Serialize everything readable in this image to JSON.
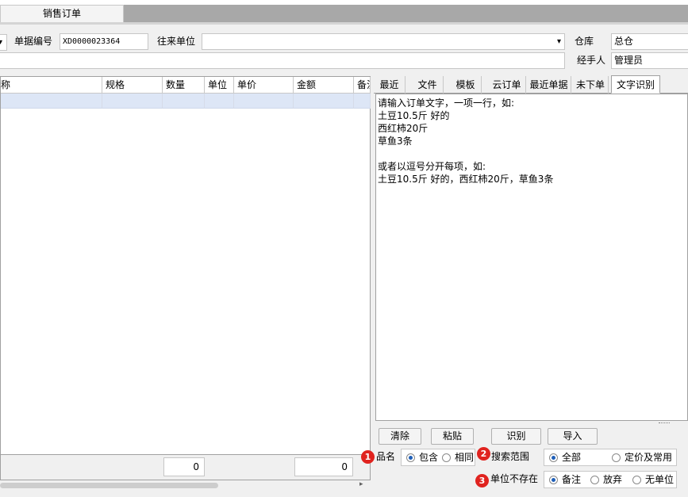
{
  "tabs": {
    "active": "销售订单"
  },
  "form": {
    "doc_no_label": "单据编号",
    "doc_no_value": "XD0000023364",
    "partner_label": "往来单位",
    "partner_value": "",
    "warehouse_label": "仓库",
    "warehouse_value": "总仓",
    "handler_label": "经手人",
    "handler_value": "管理员",
    "dropdown_arrow": "▾"
  },
  "grid": {
    "columns": [
      "称",
      "规格",
      "数量",
      "单位",
      "单价",
      "金额",
      "备注"
    ],
    "totals": {
      "quantity": "0",
      "amount": "0"
    }
  },
  "side_tabs": [
    "最近",
    "文件",
    "模板",
    "云订单",
    "最近单据",
    "未下单",
    "文字识别"
  ],
  "recognize": {
    "lines": [
      "请输入订单文字，一项一行，如:",
      "土豆10.5斤 好的",
      "西红柿20斤",
      "草鱼3条",
      "",
      "或者以逗号分开每项，如:",
      "土豆10.5斤 好的，西红柿20斤，草鱼3条"
    ],
    "buttons": {
      "clear": "清除",
      "paste": "粘贴",
      "recognize": "识别",
      "import": "导入"
    },
    "options": {
      "name_label": "品名",
      "name_choices": [
        "包含",
        "相同"
      ],
      "name_selected": "包含",
      "scope_label": "搜索范围",
      "scope_choices": [
        "全部",
        "定价及常用"
      ],
      "scope_selected": "全部",
      "unit_label": "单位不存在",
      "unit_choices": [
        "备注",
        "放弃",
        "无单位"
      ],
      "unit_selected": "备注"
    },
    "badges": [
      "1",
      "2",
      "3"
    ]
  },
  "colors": {
    "badge": "#e0231f",
    "selected_row": "#dde6f6",
    "radio_dot": "#1f5fb8"
  }
}
